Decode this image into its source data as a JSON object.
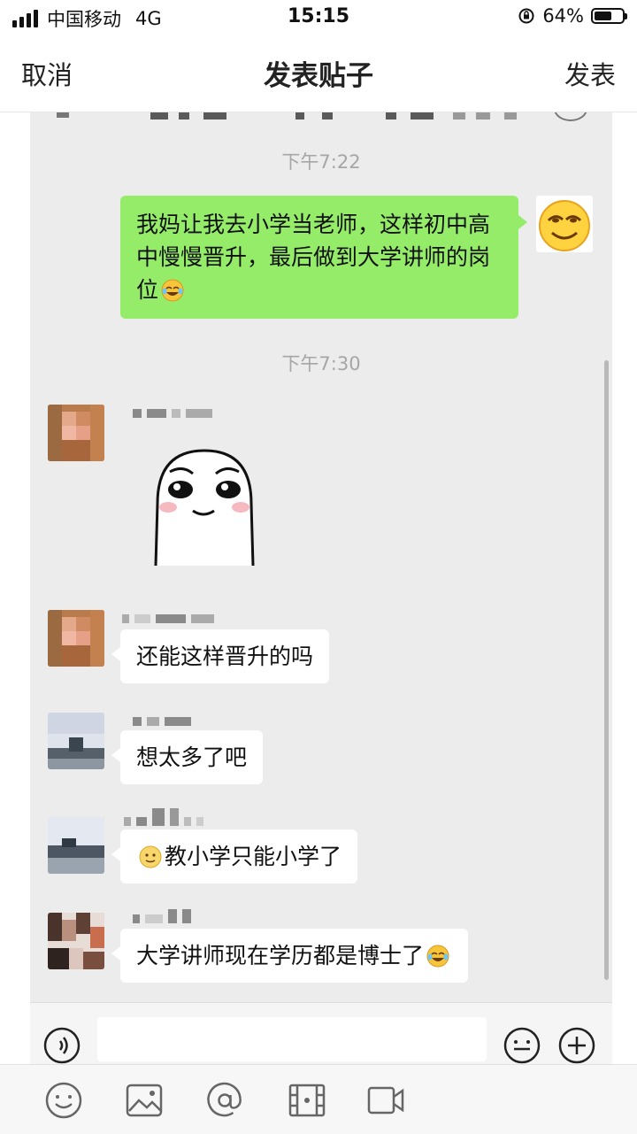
{
  "status_bar": {
    "carrier": "中国移动",
    "network": "4G",
    "time": "15:15",
    "battery_percent": "64%",
    "battery_level": 0.64,
    "icons": [
      "signal-icon",
      "rotation-lock-icon",
      "battery-icon"
    ]
  },
  "nav_bar": {
    "cancel_label": "取消",
    "title": "发表贴子",
    "post_label": "发表"
  },
  "chat": {
    "timestamps": [
      "下午7:22",
      "下午7:30"
    ],
    "messages": [
      {
        "side": "right",
        "type": "text",
        "text": "我妈让我去小学当老师，这样初中高中慢慢晋升，最后做到大学讲师的岗位",
        "trailing_emoji": "laugh-cry-emoji"
      },
      {
        "side": "left",
        "type": "sticker",
        "sticker": "shy-face-sticker"
      },
      {
        "side": "left",
        "type": "text",
        "text": "还能这样晋升的吗"
      },
      {
        "side": "left",
        "type": "text",
        "text": "想太多了吧"
      },
      {
        "side": "left",
        "type": "text",
        "text": "教小学只能小学了",
        "leading_emoji": "smile-emoji"
      },
      {
        "side": "left",
        "type": "text",
        "text": "大学讲师现在学历都是博士了",
        "trailing_emoji": "laugh-cry-emoji"
      }
    ]
  },
  "bottom_toolbar": {
    "icons": [
      "emoji-icon",
      "image-icon",
      "mention-icon",
      "video-clip-icon",
      "video-icon"
    ]
  },
  "colors": {
    "green_bubble": "#95ec69",
    "white_bubble": "#ffffff",
    "chat_background": "#ececec",
    "timestamp_gray": "#a6a6a6"
  }
}
